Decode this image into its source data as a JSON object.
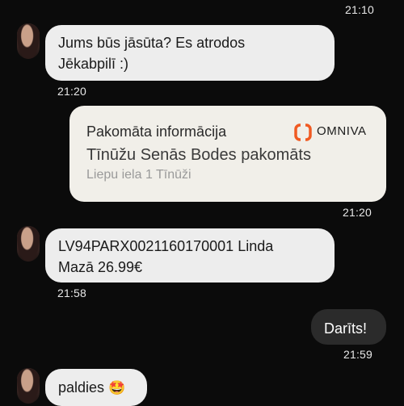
{
  "messages": {
    "t0": "21:10",
    "m1": {
      "line1": "Jums būs jāsūta? Es atrodos",
      "line2": "Jēkabpilī :)",
      "time": "21:20"
    },
    "card": {
      "title": "Pakomāta informācija",
      "brand": "OMNIVA",
      "location": "Tīnūžu Senās Bodes pakomāts",
      "address": "Liepu iela 1 Tīnūži",
      "time": "21:20"
    },
    "m2": {
      "line1": "LV94PARX0021160170001 Linda",
      "line2": "Mazā 26.99€",
      "time": "21:58"
    },
    "m3": {
      "text": "Darīts!",
      "time": "21:59"
    },
    "m4": {
      "text": "paldies",
      "emoji": "🤩"
    }
  },
  "icons": {
    "avatar": "contact-avatar",
    "brand_logo": "omniva-logo-icon"
  },
  "colors": {
    "background": "#0b0b0b",
    "incoming": "#ededed",
    "outgoing": "#2b2b2b",
    "omniva": "#f05a22"
  }
}
